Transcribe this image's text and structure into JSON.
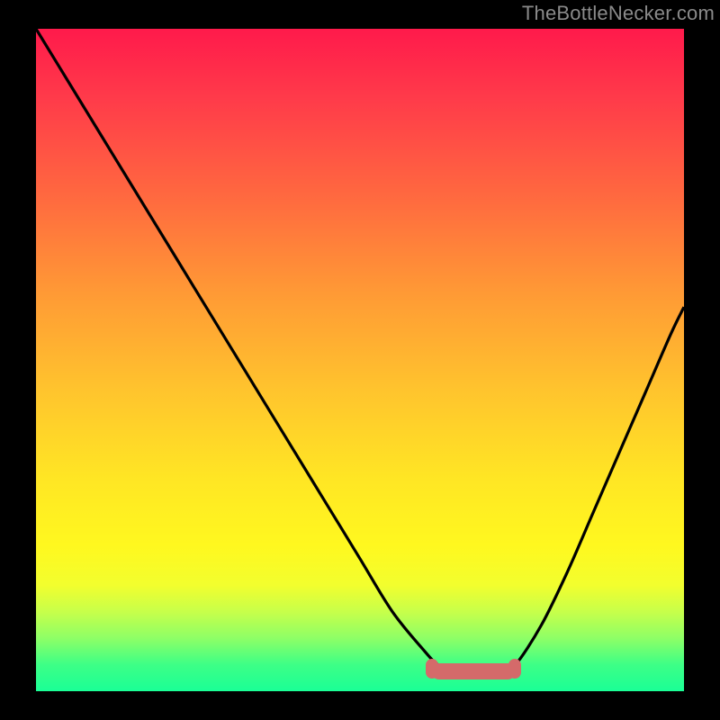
{
  "watermark": "TheBottleNecker.com",
  "colors": {
    "frame": "#000000",
    "curve": "#000000",
    "valley_marker": "#d46a6a",
    "gradient_stops": [
      "#ff1a4b",
      "#ff394a",
      "#ff6b3f",
      "#ff9a35",
      "#ffc52d",
      "#ffe624",
      "#fff81f",
      "#f2fe2e",
      "#c7ff4a",
      "#8eff66",
      "#3dff86",
      "#1aff96"
    ]
  },
  "chart_data": {
    "type": "line",
    "title": "",
    "xlabel": "",
    "ylabel": "",
    "xlim": [
      0,
      100
    ],
    "ylim": [
      0,
      100
    ],
    "grid": false,
    "legend": false,
    "series": [
      {
        "name": "bottleneck-curve",
        "x": [
          0,
          5,
          10,
          15,
          20,
          25,
          30,
          35,
          40,
          45,
          50,
          55,
          60,
          62,
          64,
          66,
          68,
          70,
          72,
          74,
          78,
          82,
          86,
          90,
          94,
          98,
          100
        ],
        "y": [
          100,
          92,
          84,
          76,
          68,
          60,
          52,
          44,
          36,
          28,
          20,
          12,
          6,
          4,
          3,
          2.5,
          2.5,
          2.5,
          3,
          4,
          10,
          18,
          27,
          36,
          45,
          54,
          58
        ]
      }
    ],
    "valley_marker": {
      "x_start": 61,
      "x_end": 74,
      "y": 3
    }
  }
}
